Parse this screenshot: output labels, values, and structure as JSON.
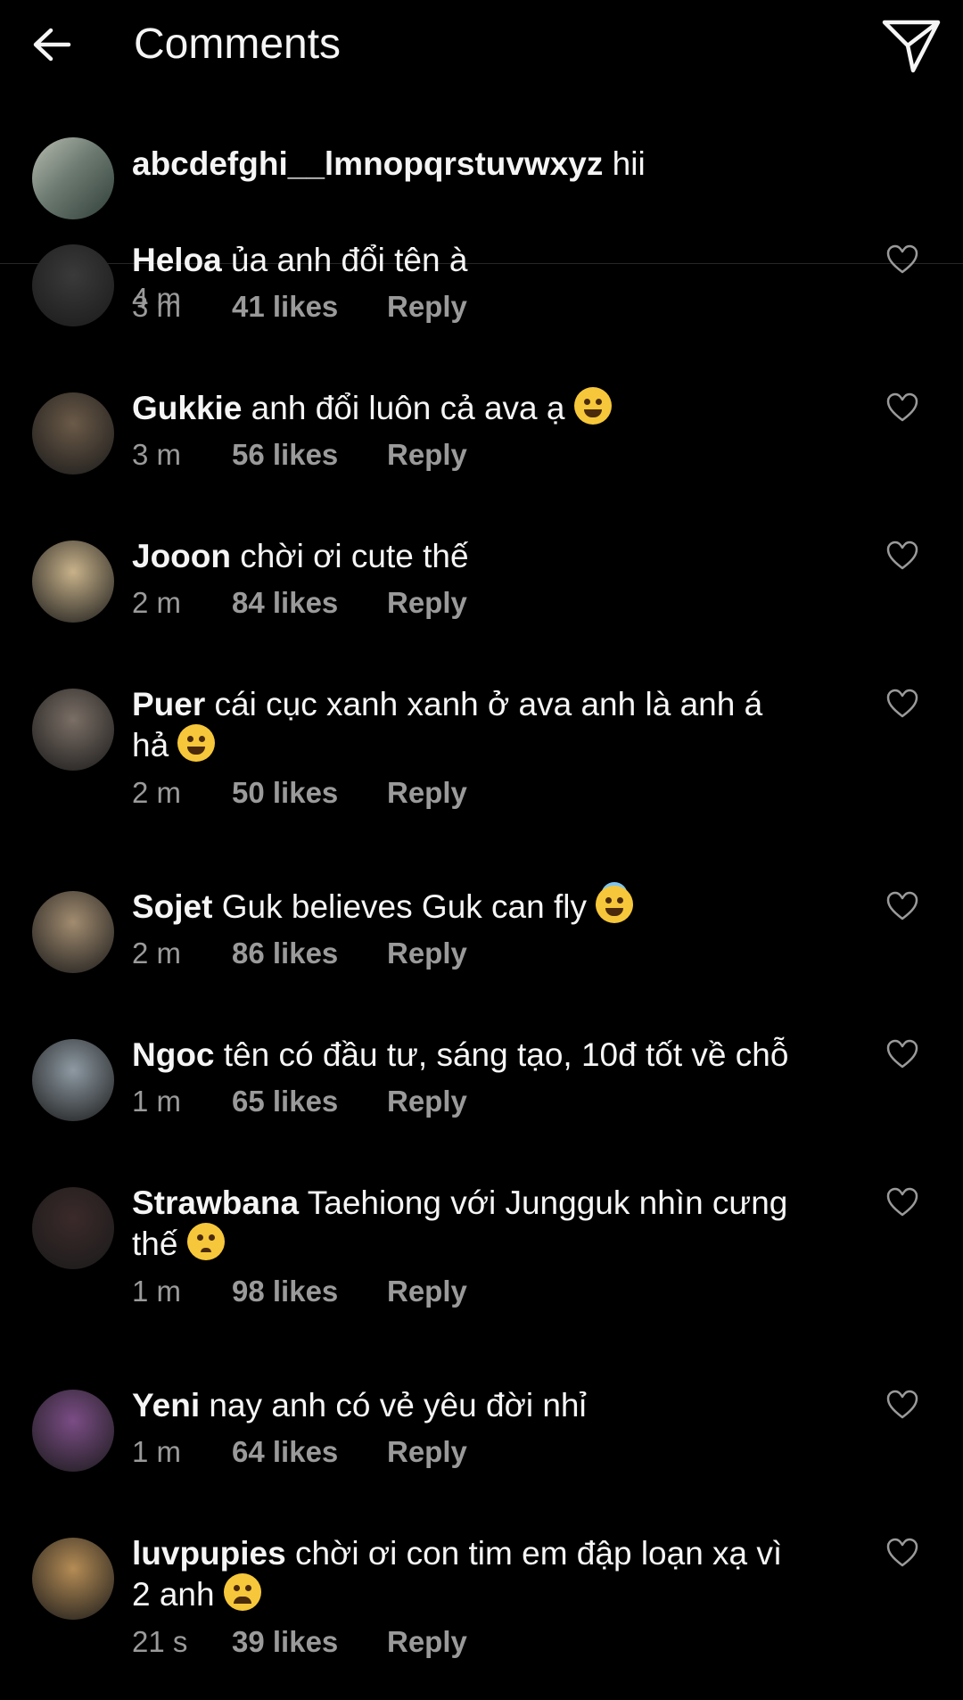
{
  "header": {
    "title": "Comments"
  },
  "caption": {
    "username": "abcdefghi__lmnopqrstuvwxyz",
    "text": " hii",
    "time": "4 m"
  },
  "comments": [
    {
      "username": "Heloa",
      "text": " ủa anh đổi tên à",
      "line2": "",
      "time": "3 m",
      "likes": "41 likes",
      "reply": "Reply",
      "avatar_color": "#3a3a3a"
    },
    {
      "username": "Gukkie",
      "text": " anh đổi luôn cả ava ạ",
      "line2": "",
      "time": "3 m",
      "likes": "56 likes",
      "reply": "Reply",
      "avatar_color": "#6b5a48"
    },
    {
      "username": "Jooon",
      "text": " chời ơi cute thế",
      "line2": "",
      "time": "2 m",
      "likes": "84 likes",
      "reply": "Reply",
      "avatar_color": "#c8b28a"
    },
    {
      "username": "Puer",
      "text": " cái cục xanh xanh ở ava anh là anh á",
      "line2": "hả",
      "time": "2 m",
      "likes": "50 likes",
      "reply": "Reply",
      "avatar_color": "#7b6f66"
    },
    {
      "username": "Sojet",
      "text": " Guk believes Guk can fly",
      "line2": "",
      "time": "2 m",
      "likes": "86 likes",
      "reply": "Reply",
      "avatar_color": "#a28c70"
    },
    {
      "username": "Ngoc",
      "text": " tên có đầu tư, sáng tạo, 10đ tốt về chỗ",
      "line2": "",
      "time": "1 m",
      "likes": "65 likes",
      "reply": "Reply",
      "avatar_color": "#8e9aa3"
    },
    {
      "username": "Strawbana",
      "text": " Taehiong với Jungguk nhìn cưng",
      "line2": "thế",
      "time": "1 m",
      "likes": "98 likes",
      "reply": "Reply",
      "avatar_color": "#3b2a2a"
    },
    {
      "username": "Yeni",
      "text": " nay anh có vẻ yêu đời nhỉ",
      "line2": "",
      "time": "1 m",
      "likes": "64 likes",
      "reply": "Reply",
      "avatar_color": "#7b4d86"
    },
    {
      "username": "luvpupies",
      "text": " chời ơi con tim em đập loạn xạ vì",
      "line2": "2 anh",
      "time": "21 s",
      "likes": "39 likes",
      "reply": "Reply",
      "avatar_color": "#b58c55"
    }
  ]
}
